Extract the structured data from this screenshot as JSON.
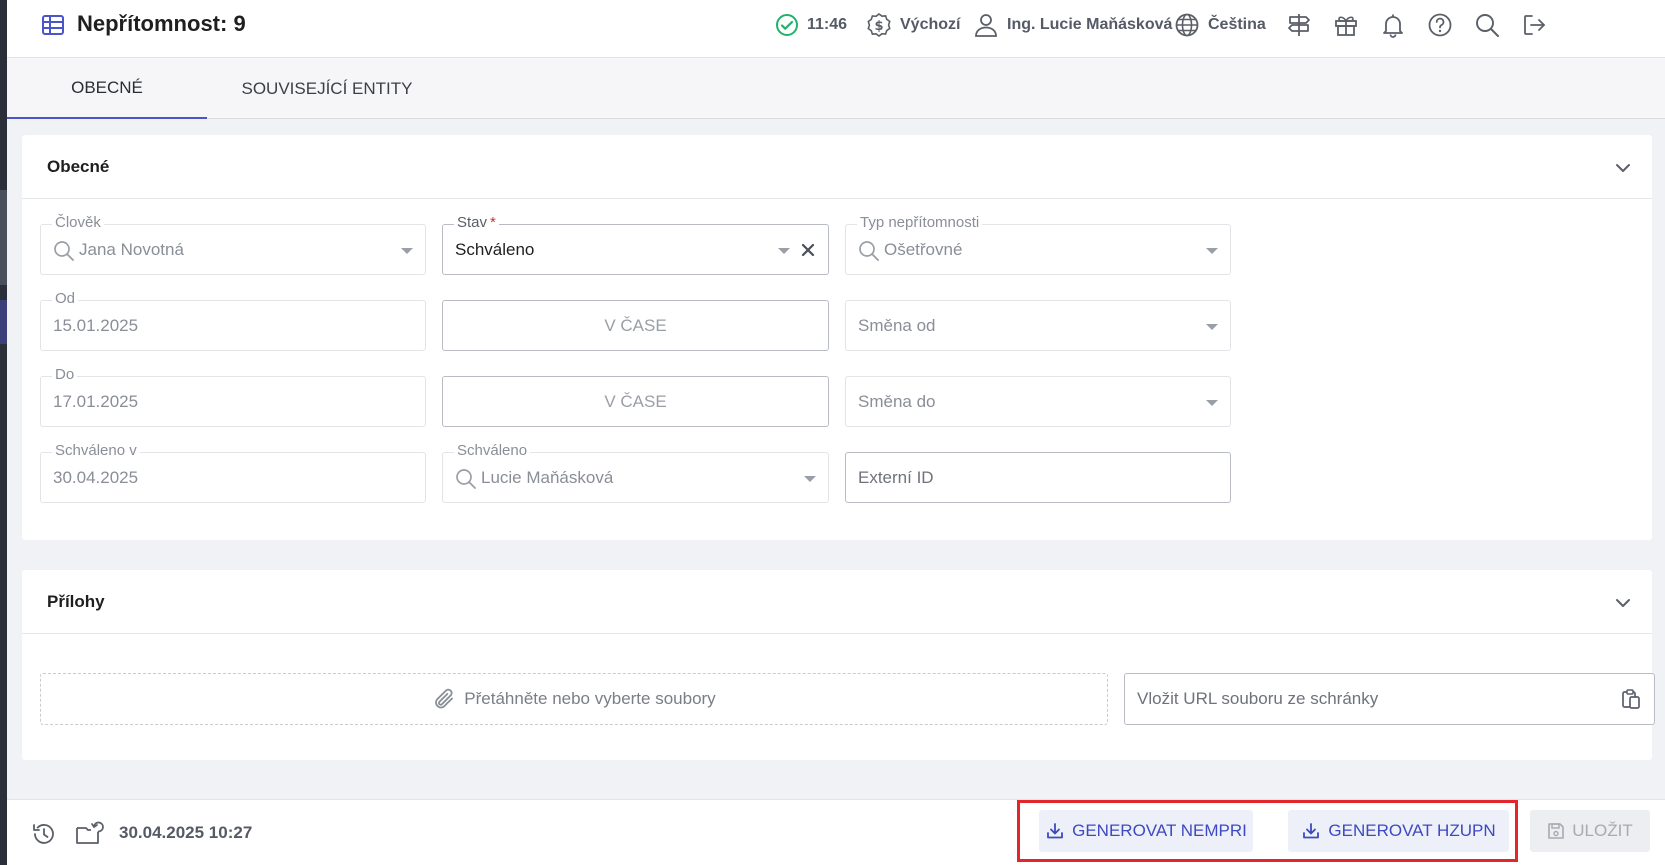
{
  "header": {
    "title": "Nepřítomnost: 9",
    "time": "11:46",
    "currency": "Výchozí",
    "user": "Ing. Lucie Maňásková",
    "language": "Čeština",
    "icons": [
      "check-circle-icon",
      "dollar-icon",
      "user-icon",
      "globe-icon",
      "signpost-icon",
      "gift-icon",
      "bell-icon",
      "help-icon",
      "search-icon",
      "logout-icon"
    ],
    "status_color": "#1fb36b"
  },
  "tabs": [
    {
      "label": "OBECNÉ",
      "active": true
    },
    {
      "label": "SOUVISEJÍCÍ ENTITY",
      "active": false
    }
  ],
  "general": {
    "title": "Obecné",
    "person": {
      "label": "Člověk",
      "value": "Jana Novotná"
    },
    "state": {
      "label": "Stav",
      "required_mark": "*",
      "value": "Schváleno"
    },
    "absence_type": {
      "label": "Typ nepřítomnosti",
      "value": "Ošetřovné"
    },
    "from": {
      "label": "Od",
      "value": "15.01.2025"
    },
    "from_time_button": "V ČASE",
    "shift_from": {
      "placeholder": "Směna od"
    },
    "to": {
      "label": "Do",
      "value": "17.01.2025"
    },
    "to_time_button": "V ČASE",
    "shift_to": {
      "placeholder": "Směna do"
    },
    "approved_at": {
      "label": "Schváleno v",
      "value": "30.04.2025"
    },
    "approved_by": {
      "label": "Schváleno",
      "value": "Lucie Maňásková"
    },
    "external_id": {
      "placeholder": "Externí ID"
    }
  },
  "attachments": {
    "title": "Přílohy",
    "dropzone": "Přetáhněte nebo vyberte soubory",
    "url_placeholder": "Vložit URL souboru ze schránky"
  },
  "footer": {
    "timestamp": "30.04.2025 10:27",
    "generate_nempri": "GENEROVAT NEMPRI",
    "generate_hzupn": "GENEROVAT HZUPN",
    "save": "ULOŽIT",
    "accent_color": "#3d49c1",
    "highlight_color": "#e3262c"
  }
}
